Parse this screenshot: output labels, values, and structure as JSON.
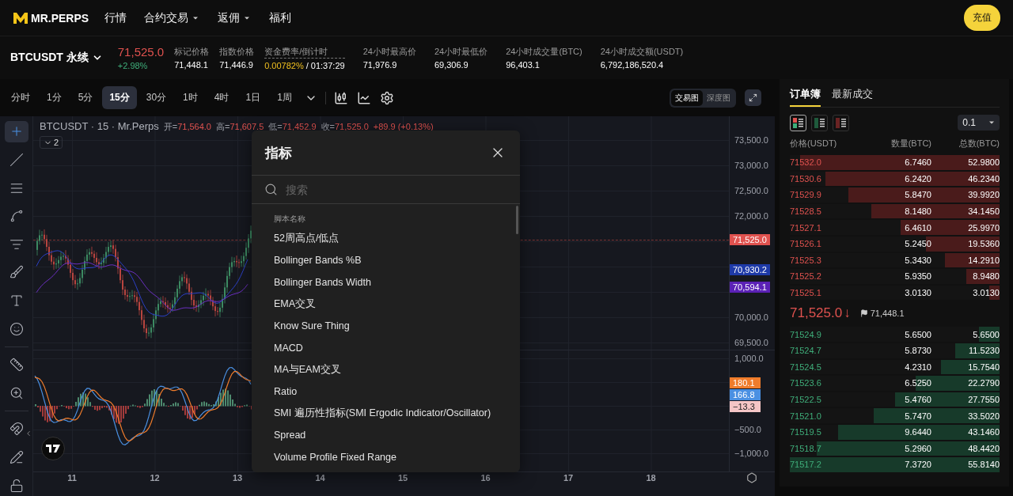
{
  "header": {
    "logo": "MR.PERPS",
    "nav": [
      {
        "label": "行情",
        "dropdown": false
      },
      {
        "label": "合约交易",
        "dropdown": true
      },
      {
        "label": "返佣",
        "dropdown": true
      },
      {
        "label": "福利",
        "dropdown": false
      }
    ],
    "deposit_button": "充值"
  },
  "ticker": {
    "symbol": "BTCUSDT 永续",
    "price": "71,525.0",
    "change": "+2.98%",
    "stats": [
      {
        "label": "标记价格",
        "value": "71,448.1"
      },
      {
        "label": "指数价格",
        "value": "71,446.9"
      },
      {
        "label": "资金费率/倒计时",
        "value": "0.00782%",
        "extra": "/ 01:37:29"
      },
      {
        "label": "24小时最高价",
        "value": "71,976.9"
      },
      {
        "label": "24小时最低价",
        "value": "69,306.9"
      },
      {
        "label": "24小时成交量(BTC)",
        "value": "96,403.1"
      },
      {
        "label": "24小时成交额(USDT)",
        "value": "6,792,186,520.4"
      }
    ]
  },
  "intervals": [
    {
      "label": "分时",
      "selected": false
    },
    {
      "label": "1分",
      "selected": false
    },
    {
      "label": "5分",
      "selected": false
    },
    {
      "label": "15分",
      "selected": true
    },
    {
      "label": "30分",
      "selected": false
    },
    {
      "label": "1时",
      "selected": false
    },
    {
      "label": "4时",
      "selected": false
    },
    {
      "label": "1日",
      "selected": false
    },
    {
      "label": "1周",
      "selected": false
    }
  ],
  "view_toggle": [
    {
      "label": "交易图",
      "selected": true
    },
    {
      "label": "深度图",
      "selected": false
    }
  ],
  "chart": {
    "legend_title": "BTCUSDT · 15 · Mr.Perps",
    "ohlc": [
      {
        "label": "开=",
        "value": "71,564.0"
      },
      {
        "label": "高=",
        "value": "71,607.5"
      },
      {
        "label": "低=",
        "value": "71,452.9"
      },
      {
        "label": "收=",
        "value": "71,525.0"
      }
    ],
    "legend_change": "+89.9 (+0.13%)",
    "indicator_count": "2",
    "price_ticks": [
      "73,500.0",
      "73,000.0",
      "72,500.0",
      "72,000.0",
      "70,000.0",
      "69,500.0"
    ],
    "price_badges": [
      {
        "value": "71,525.0",
        "color": "#e0524f"
      },
      {
        "value": "70,930.2",
        "color": "#1e3aa8"
      },
      {
        "value": "70,594.1",
        "color": "#5b21b6"
      }
    ],
    "macd_ticks": [
      "1,000.0",
      "−500.0",
      "−1,000.0"
    ],
    "macd_badges": [
      {
        "value": "180.1",
        "color": "#f07c2b"
      },
      {
        "value": "166.8",
        "color": "#4a90e2"
      },
      {
        "value": "−13.3",
        "color": "#f5c6c6"
      }
    ],
    "time_ticks": [
      "11",
      "12",
      "13",
      "14",
      "15",
      "16",
      "17",
      "18"
    ]
  },
  "indicator_dialog": {
    "title": "指标",
    "search_placeholder": "搜索",
    "section": "脚本名称",
    "items": [
      "52周高点/低点",
      "Bollinger Bands %B",
      "Bollinger Bands Width",
      "EMA交叉",
      "Know Sure Thing",
      "MACD",
      "MA与EAM交叉",
      "Ratio",
      "SMI 遍历性指标(SMI Ergodic Indicator/Oscillator)",
      "Spread",
      "Volume Profile Fixed Range"
    ]
  },
  "order_book": {
    "tabs": [
      {
        "label": "订单簿",
        "selected": true
      },
      {
        "label": "最新成交",
        "selected": false
      }
    ],
    "layouts": [
      {
        "kind": "both",
        "selected": true
      },
      {
        "kind": "bids",
        "selected": false
      },
      {
        "kind": "asks",
        "selected": false
      }
    ],
    "precision": "0.1",
    "columns": [
      "价格(USDT)",
      "数量(BTC)",
      "总数(BTC)"
    ],
    "asks": [
      {
        "price": "71532.0",
        "amount": "6.7460",
        "total": "52.9800",
        "level": 0.95
      },
      {
        "price": "71530.6",
        "amount": "6.2420",
        "total": "46.2340",
        "level": 0.83
      },
      {
        "price": "71529.9",
        "amount": "5.8470",
        "total": "39.9920",
        "level": 0.72
      },
      {
        "price": "71528.5",
        "amount": "8.1480",
        "total": "34.1450",
        "level": 0.61
      },
      {
        "price": "71527.1",
        "amount": "6.4610",
        "total": "25.9970",
        "level": 0.47
      },
      {
        "price": "71526.1",
        "amount": "5.2450",
        "total": "19.5360",
        "level": 0.35
      },
      {
        "price": "71525.3",
        "amount": "5.3430",
        "total": "14.2910",
        "level": 0.26
      },
      {
        "price": "71525.2",
        "amount": "5.9350",
        "total": "8.9480",
        "level": 0.16
      },
      {
        "price": "71525.1",
        "amount": "3.0130",
        "total": "3.0130",
        "level": 0.05
      }
    ],
    "last_price": "71,525.0",
    "last_arrow": "↓",
    "mark_price": "71,448.1",
    "bids": [
      {
        "price": "71524.9",
        "amount": "5.6500",
        "total": "5.6500",
        "level": 0.1
      },
      {
        "price": "71524.7",
        "amount": "5.8730",
        "total": "11.5230",
        "level": 0.21
      },
      {
        "price": "71524.5",
        "amount": "4.2310",
        "total": "15.7540",
        "level": 0.28
      },
      {
        "price": "71523.6",
        "amount": "6.5250",
        "total": "22.2790",
        "level": 0.4
      },
      {
        "price": "71522.5",
        "amount": "5.4760",
        "total": "27.7550",
        "level": 0.5
      },
      {
        "price": "71521.0",
        "amount": "5.7470",
        "total": "33.5020",
        "level": 0.6
      },
      {
        "price": "71519.5",
        "amount": "9.6440",
        "total": "43.1460",
        "level": 0.77
      },
      {
        "price": "71518.7",
        "amount": "5.2960",
        "total": "48.4420",
        "level": 0.87
      },
      {
        "price": "71517.2",
        "amount": "7.3720",
        "total": "55.8140",
        "level": 1.0
      }
    ]
  }
}
